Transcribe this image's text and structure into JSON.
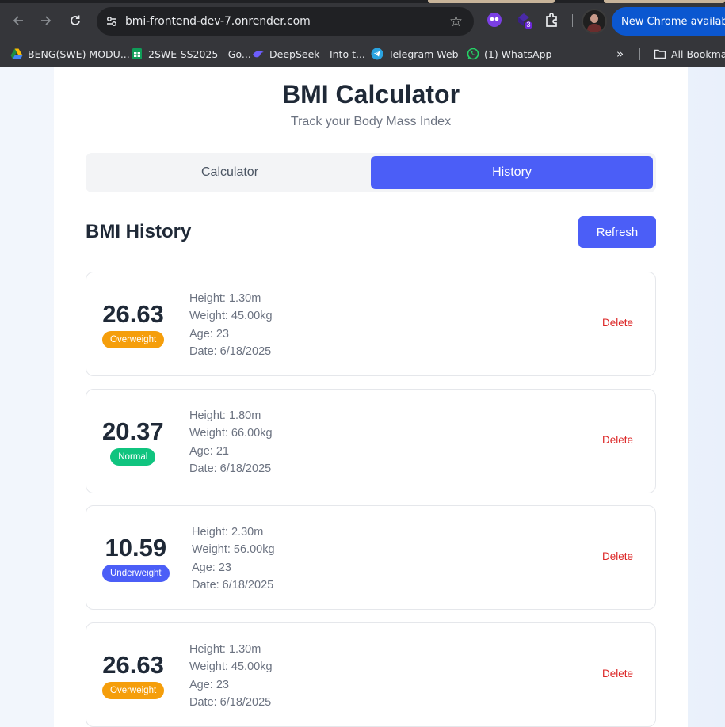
{
  "browser": {
    "url": "bmi-frontend-dev-7.onrender.com",
    "extension_badge": "3",
    "update_label": "New Chrome available",
    "bookmarks": [
      {
        "label": "BENG(SWE) MODU...",
        "icon": "google-drive-icon"
      },
      {
        "label": "2SWE-SS2025 - Go...",
        "icon": "sheets-icon"
      },
      {
        "label": "DeepSeek - Into t...",
        "icon": "deepseek-icon"
      },
      {
        "label": "Telegram Web",
        "icon": "telegram-icon"
      },
      {
        "label": "(1) WhatsApp",
        "icon": "whatsapp-icon"
      }
    ],
    "all_bookmarks": "All Bookmarks"
  },
  "app": {
    "title": "BMI Calculator",
    "subtitle": "Track your Body Mass Index",
    "tabs": {
      "calculator": "Calculator",
      "history": "History"
    },
    "history_title": "BMI History",
    "refresh_label": "Refresh",
    "delete_label": "Delete",
    "category_colors": {
      "Overweight": "#f59e0b",
      "Normal": "#10c47f",
      "Underweight": "#4b5ef7"
    }
  },
  "entries": [
    {
      "bmi": "26.63",
      "category": "Overweight",
      "height": "Height: 1.30m",
      "weight": "Weight: 45.00kg",
      "age": "Age: 23",
      "date": "Date: 6/18/2025"
    },
    {
      "bmi": "20.37",
      "category": "Normal",
      "height": "Height: 1.80m",
      "weight": "Weight: 66.00kg",
      "age": "Age: 21",
      "date": "Date: 6/18/2025"
    },
    {
      "bmi": "10.59",
      "category": "Underweight",
      "height": "Height: 2.30m",
      "weight": "Weight: 56.00kg",
      "age": "Age: 23",
      "date": "Date: 6/18/2025"
    },
    {
      "bmi": "26.63",
      "category": "Overweight",
      "height": "Height: 1.30m",
      "weight": "Weight: 45.00kg",
      "age": "Age: 23",
      "date": "Date: 6/18/2025"
    }
  ]
}
